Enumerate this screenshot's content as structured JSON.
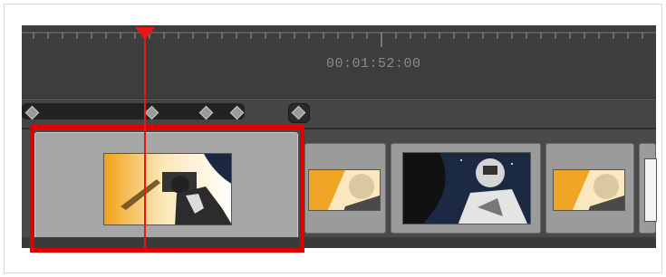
{
  "timeline": {
    "timecode": "00:01:52:00",
    "colors": {
      "background": "#3c3c3c",
      "playhead": "#e81818",
      "selection": "#e00000",
      "panel": "#9b9b9b"
    }
  },
  "panels": [
    {
      "name": "panel-1",
      "selected": true,
      "thumb": "astronaut-blaster-closeup"
    },
    {
      "name": "panel-2",
      "selected": false,
      "thumb": "astronaut-light-flare"
    },
    {
      "name": "panel-3",
      "selected": false,
      "thumb": "astronaut-space-helmet"
    },
    {
      "name": "panel-4",
      "selected": false,
      "thumb": "astronaut-light-flare-2"
    },
    {
      "name": "panel-5",
      "selected": false,
      "thumb": "blank"
    }
  ],
  "icons": [
    "playhead-marker-icon",
    "keyframe-diamond-icon"
  ]
}
